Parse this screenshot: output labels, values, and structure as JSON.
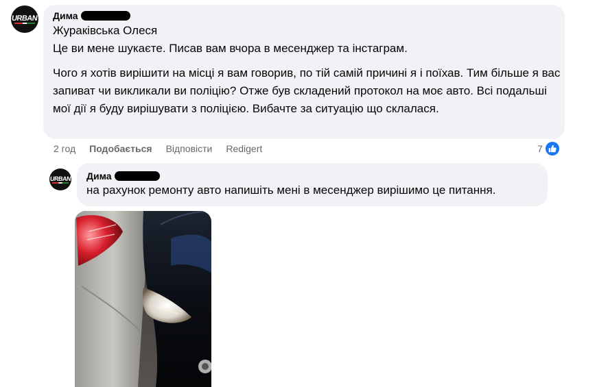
{
  "comment": {
    "author": "Дима",
    "avatar_logo": "URBAN",
    "addressee": "Жураківська Олеся",
    "paragraphs": [
      "Це ви мене шукаєте. Писав вам вчора в месенджер та інстаграм.",
      "Чого я хотів вирішити на місці я вам говорив, по тій самій причині я і поїхав. Тим більше я вас запиват чи викликали ви поліцію? Отже був складений протокол на моє авто. Всі подальші мої дії я буду вирішувати з поліцією. Вибачте за ситуацію що склалася."
    ],
    "time": "2 год",
    "like_label": "Подобається",
    "reply_label": "Відповісти",
    "edited_label": "Redigert",
    "reaction_count": "7",
    "reaction_icon": "thumbs-up-icon",
    "reaction_color": "#1877f2"
  },
  "reply": {
    "author": "Дима",
    "avatar_logo": "URBAN",
    "text": "на рахунок ремонту авто напишіть мені в месенджер вирішимо це питання.",
    "photo_alt": "photo-of-damaged-cars"
  },
  "colors": {
    "bubble": "#f0f2f5",
    "secondary_text": "#65676b",
    "primary_text": "#050505"
  }
}
